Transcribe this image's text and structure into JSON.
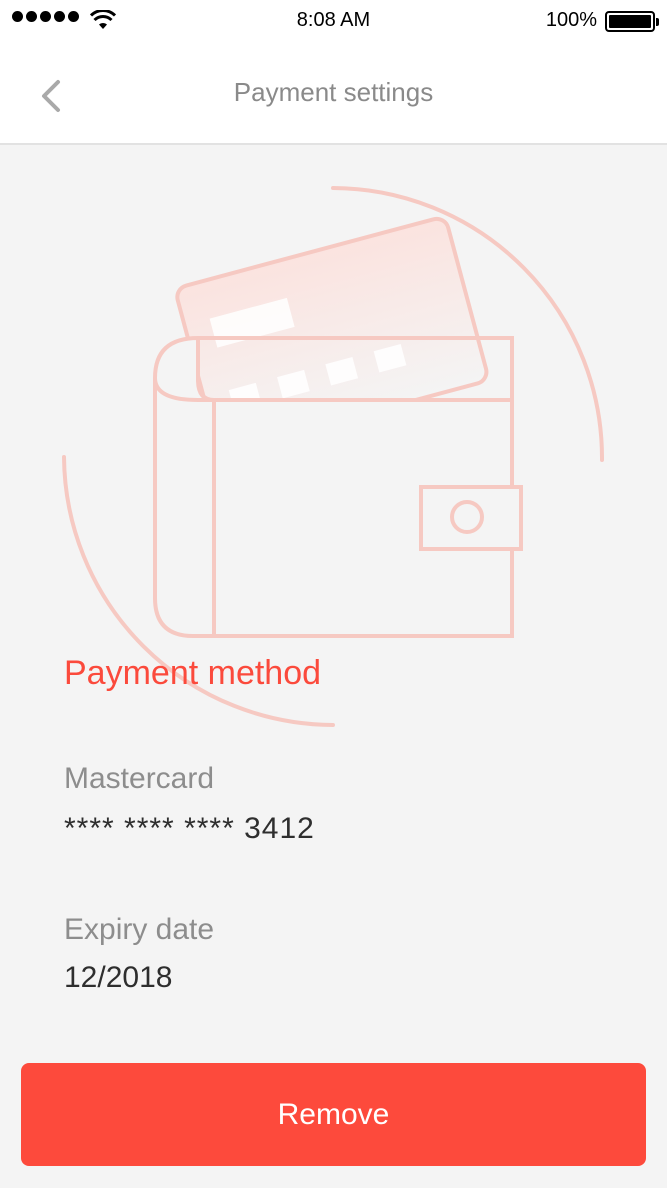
{
  "status_bar": {
    "time": "8:08 AM",
    "battery": "100%"
  },
  "nav": {
    "title": "Payment settings",
    "back_icon": "chevron-left-icon"
  },
  "illustration": {
    "icon": "wallet-card-icon",
    "color": "#f6c9c2"
  },
  "payment": {
    "section_title": "Payment method",
    "card_label": "Mastercard",
    "card_number": "**** **** **** 3412",
    "expiry_label": "Expiry date",
    "expiry_value": "12/2018"
  },
  "actions": {
    "remove_label": "Remove"
  },
  "colors": {
    "accent": "#fd4a3c",
    "background": "#f4f4f4"
  }
}
